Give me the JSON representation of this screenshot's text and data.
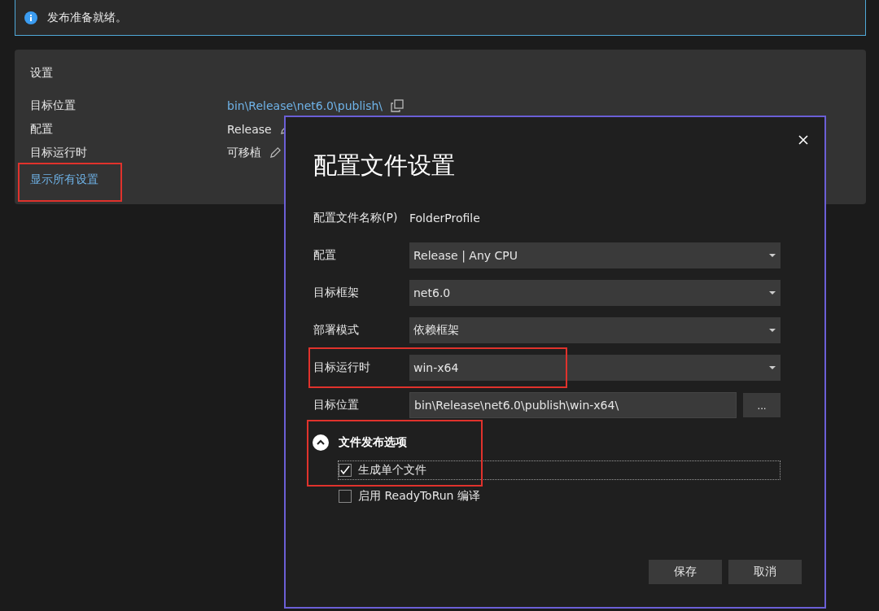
{
  "info_bar": {
    "message": "发布准备就绪。"
  },
  "settings": {
    "title": "设置",
    "rows": [
      {
        "label": "目标位置",
        "value": "bin\\Release\\net6.0\\publish\\",
        "kind": "link"
      },
      {
        "label": "配置",
        "value": "Release",
        "kind": "editable"
      },
      {
        "label": "目标运行时",
        "value": "可移植",
        "kind": "editable"
      }
    ],
    "show_all_link": {
      "text": "显示所有设置",
      "highlighted": true
    }
  },
  "dialog": {
    "title": "配置文件设置",
    "profile_name": {
      "label": "配置文件名称(P)",
      "value": "FolderProfile"
    },
    "fields": [
      {
        "label": "配置",
        "value": "Release | Any CPU",
        "kind": "dropdown",
        "highlighted": false
      },
      {
        "label": "目标框架",
        "value": "net6.0",
        "kind": "dropdown",
        "highlighted": false
      },
      {
        "label": "部署模式",
        "value": "依赖框架",
        "kind": "dropdown",
        "highlighted": false
      },
      {
        "label": "目标运行时",
        "value": "win-x64",
        "kind": "dropdown",
        "highlighted": true
      },
      {
        "label": "目标位置",
        "value": "bin\\Release\\net6.0\\publish\\win-x64\\",
        "kind": "path",
        "button": "...",
        "highlighted": false
      }
    ],
    "file_publish_options": {
      "title": "文件发布选项",
      "expanded": true,
      "highlighted": true,
      "options": [
        {
          "label": "生成单个文件",
          "checked": true,
          "focused": true
        },
        {
          "label": "启用 ReadyToRun 编译",
          "checked": false,
          "focused": false
        }
      ]
    },
    "buttons": [
      "保存",
      "取消"
    ]
  }
}
